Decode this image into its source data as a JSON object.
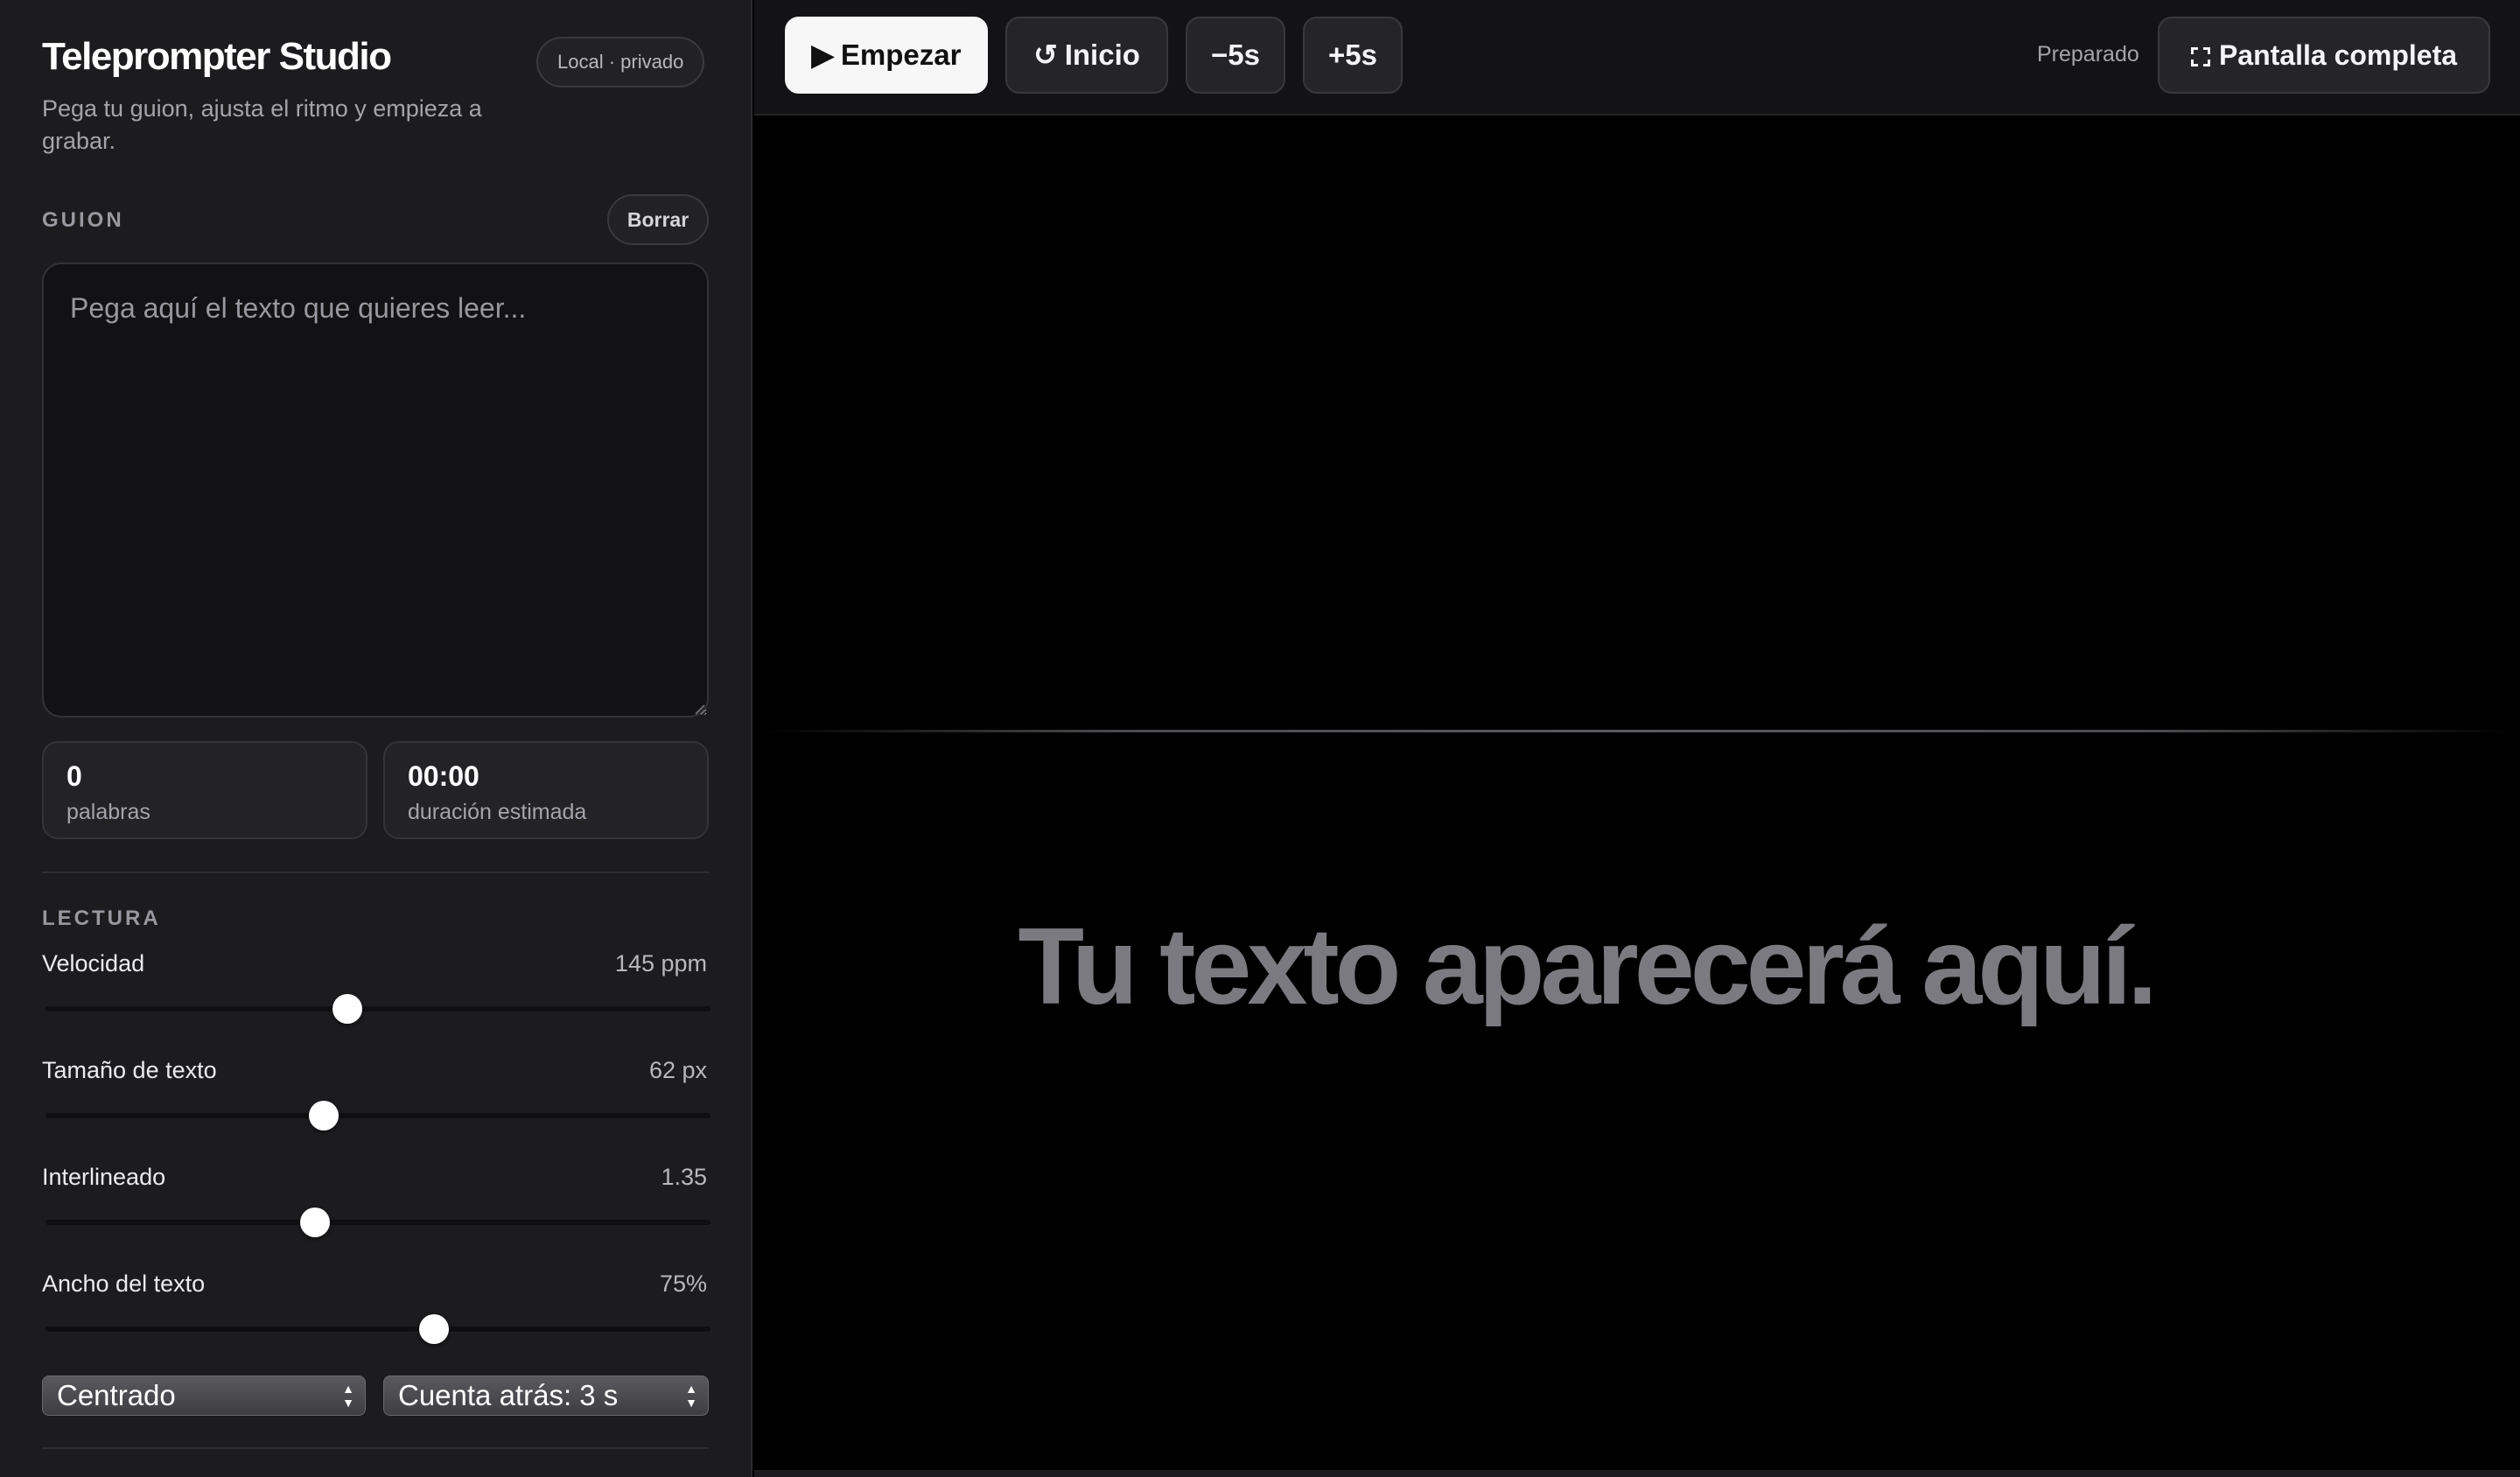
{
  "sidebar": {
    "title": "Teleprompter Studio",
    "privacy_badge": "Local · privado",
    "subtitle": "Pega tu guion, ajusta el ritmo y empieza a grabar.",
    "script_section": {
      "label": "GUION",
      "clear_label": "Borrar",
      "placeholder": "Pega aquí el texto que quieres leer...",
      "value": ""
    },
    "stats": {
      "words_value": "0",
      "words_label": "palabras",
      "duration_value": "00:00",
      "duration_label": "duración estimada"
    },
    "reading": {
      "label": "LECTURA",
      "speed": {
        "label": "Velocidad",
        "display": "145 ppm",
        "value": 145
      },
      "font_size": {
        "label": "Tamaño de texto",
        "display": "62 px",
        "value": 62
      },
      "line_height": {
        "label": "Interlineado",
        "display": "1.35",
        "value": 1.35
      },
      "text_width": {
        "label": "Ancho del texto",
        "display": "75%",
        "value": 75
      }
    },
    "alignment_select": {
      "selected": "Centrado"
    },
    "countdown_select": {
      "selected": "Cuenta atrás: 3 s"
    }
  },
  "toolbar": {
    "start_label": "Empezar",
    "start_icon": "play-icon",
    "restart_label": "Inicio",
    "restart_icon": "restart-icon",
    "back_label": "−5s",
    "forward_label": "+5s",
    "status": "Preparado",
    "fullscreen_label": "Pantalla completa",
    "fullscreen_icon": "fullscreen-icon"
  },
  "stage": {
    "placeholder_text": "Tu texto aparecerá aquí."
  },
  "colors": {
    "sidebar_bg": "#1c1c1e",
    "stage_bg": "#000000",
    "primary_button_bg": "#f7f7f8",
    "stage_text": "#7a7a80"
  }
}
